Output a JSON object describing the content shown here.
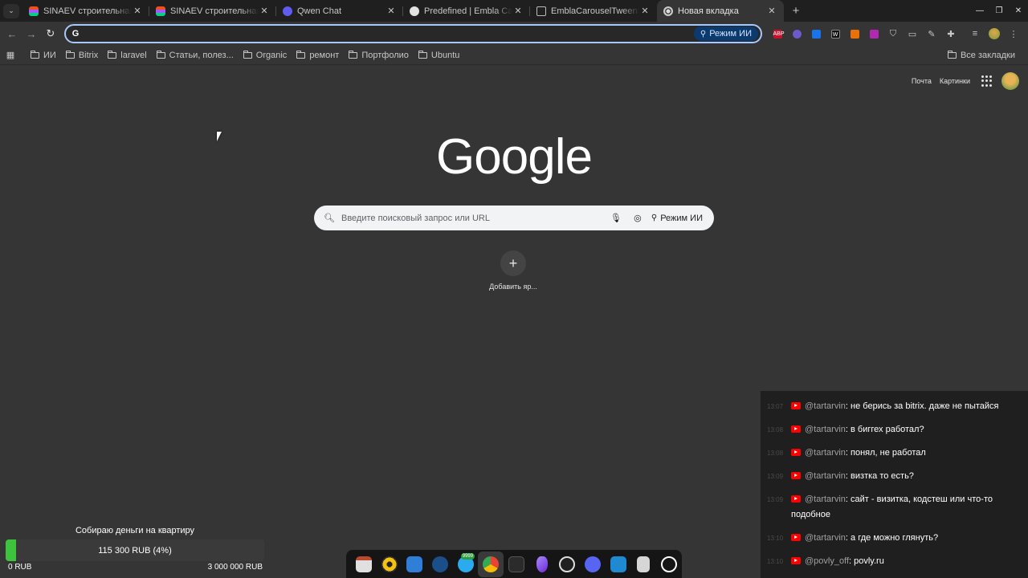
{
  "browser": {
    "tabs": [
      {
        "title": "SINAEV строительная к",
        "favicon": "figma-icon"
      },
      {
        "title": "SINAEV строительная к",
        "favicon": "figma-icon"
      },
      {
        "title": "Qwen Chat",
        "favicon": "qwen-icon"
      },
      {
        "title": "Predefined | Embla Carou",
        "favicon": "github-icon"
      },
      {
        "title": "EmblaCarouselTweenSca",
        "favicon": "embla-icon"
      },
      {
        "title": "Новая вкладка",
        "favicon": "chrome-icon",
        "active": true
      }
    ],
    "new_tab_symbol": "+",
    "omnibox": {
      "value": "",
      "ai_mode_label": "Режим ИИ"
    },
    "bookmarks": [
      "ИИ",
      "Bitrix",
      "laravel",
      "Статьи, полез...",
      "Organic",
      "ремонт",
      "Портфолио",
      "Ubuntu"
    ],
    "all_bookmarks_label": "Все закладки",
    "ext_labels": {
      "adblock": "ABP",
      "screen": "W"
    }
  },
  "google": {
    "header_links": {
      "mail": "Почта",
      "images": "Картинки"
    },
    "logo": "Google",
    "search_placeholder": "Введите поисковый запрос или URL",
    "ai_mode_label": "Режим ИИ",
    "add_shortcut_symbol": "+",
    "add_shortcut_label": "Добавить яр..."
  },
  "chat": {
    "messages": [
      {
        "time": "13:07",
        "user": "@tartarvin",
        "text": "не берись за bitrix. даже не пытайся"
      },
      {
        "time": "13:08",
        "user": "@tartarvin",
        "text": "в биггех работал?"
      },
      {
        "time": "13:08",
        "user": "@tartarvin",
        "text": "понял, не работал"
      },
      {
        "time": "13:09",
        "user": "@tartarvin",
        "text": "визтка то есть?"
      },
      {
        "time": "13:09",
        "user": "@tartarvin",
        "text": "сайт - визитка, кодстеш или что-то подобное"
      },
      {
        "time": "13:10",
        "user": "@tartarvin",
        "text": "а где можно глянуть?"
      },
      {
        "time": "13:10",
        "user": "@povly_off",
        "text": "povly.ru"
      }
    ]
  },
  "donation": {
    "title": "Собираю деньги на квартиру",
    "amount_label": "115 300 RUB (4%)",
    "progress_fraction": 0.04,
    "min_label": "0 RUB",
    "max_label": "3 000 000 RUB",
    "bar_color": "#3ec33e"
  },
  "dock": {
    "items": [
      "files-icon",
      "rhythmbox-icon",
      "libreoffice-icon",
      "steam-icon",
      "telegram-icon",
      "chrome-icon",
      "terminal-icon",
      "obsidian-icon",
      "obs-icon",
      "discord-icon",
      "vscode-icon",
      "trash-icon",
      "ubuntu-icon"
    ],
    "telegram_badge": "9999"
  }
}
